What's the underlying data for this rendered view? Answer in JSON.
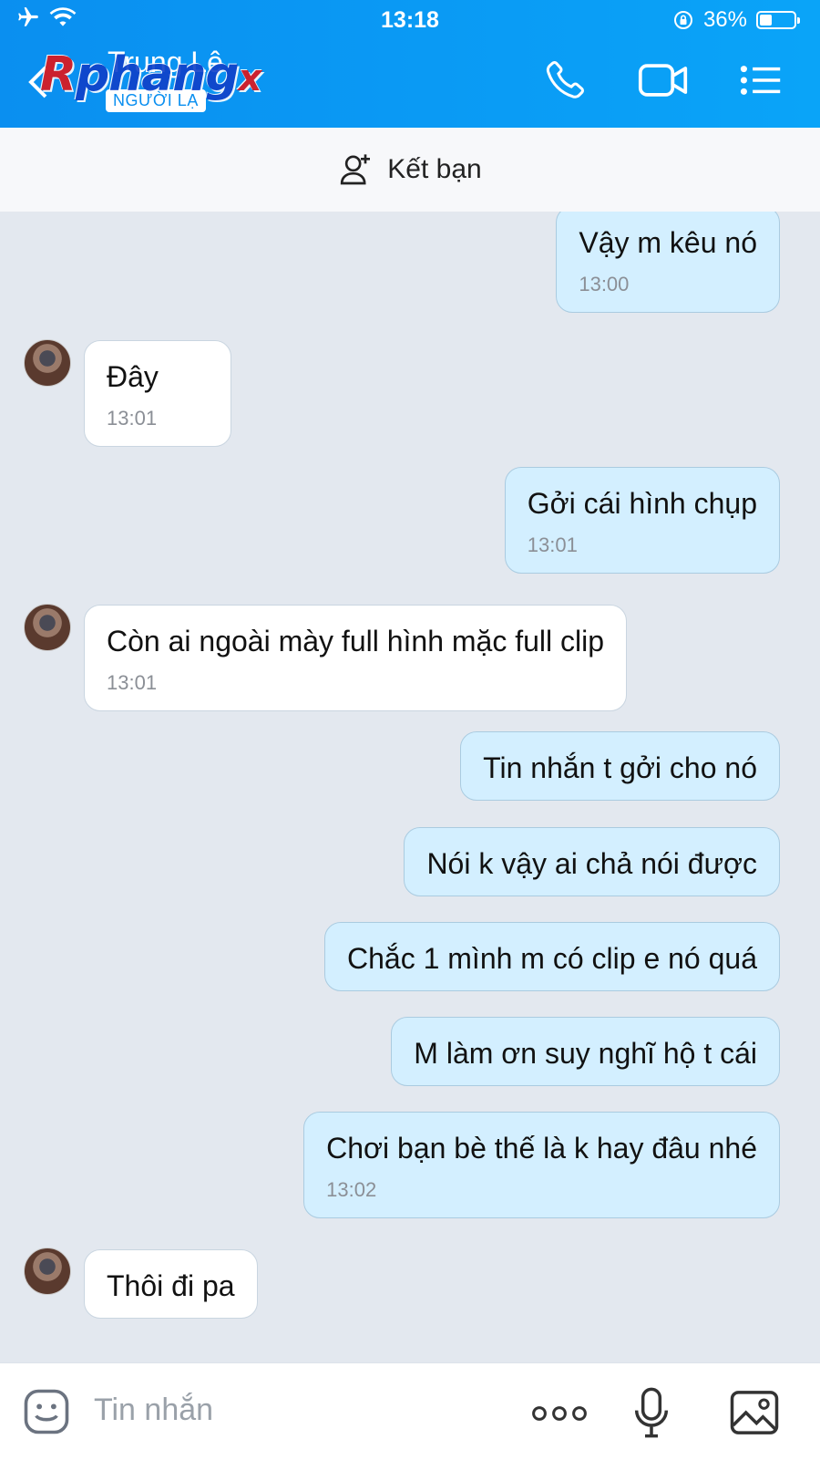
{
  "status_bar": {
    "time": "13:18",
    "battery": "36%",
    "battery_level": 0.36
  },
  "header": {
    "contact_name": "Trung Lê",
    "contact_tag": "NGƯỜI LẠ",
    "watermark": "Rphangx"
  },
  "add_friend": {
    "label": "Kết bạn"
  },
  "messages": [
    {
      "dir": "out",
      "text": "Vậy m kêu nó",
      "time": "13:00"
    },
    {
      "dir": "in",
      "text": "Đây",
      "time": "13:01"
    },
    {
      "dir": "out",
      "text": "Gởi cái hình chụp",
      "time": "13:01"
    },
    {
      "dir": "in",
      "text": "Còn ai ngoài mày full hình mặc full clip",
      "time": "13:01"
    },
    {
      "dir": "out",
      "text": "Tin nhắn t gởi cho nó",
      "time": ""
    },
    {
      "dir": "out",
      "text": "Nói k vậy ai chả nói được",
      "time": ""
    },
    {
      "dir": "out",
      "text": "Chắc 1 mình m có clip e nó quá",
      "time": ""
    },
    {
      "dir": "out",
      "text": "M làm ơn suy nghĩ hộ t cái",
      "time": ""
    },
    {
      "dir": "out",
      "text": "Chơi bạn bè thế là k hay đâu nhé",
      "time": "13:02"
    },
    {
      "dir": "in",
      "text": "Thôi đi pa",
      "time": ""
    }
  ],
  "composer": {
    "placeholder": "Tin nhắn"
  },
  "icons": [
    "airplane-icon",
    "wifi-icon",
    "rotation-lock-icon",
    "battery-icon",
    "back-icon",
    "phone-icon",
    "video-icon",
    "menu-icon",
    "add-user-icon",
    "sticker-icon",
    "more-icon",
    "mic-icon",
    "image-icon"
  ],
  "colors": {
    "header": "#0a9af5",
    "outgoing_bubble": "#d3efff",
    "incoming_bubble": "#ffffff",
    "chat_background": "#e3e8ef"
  }
}
